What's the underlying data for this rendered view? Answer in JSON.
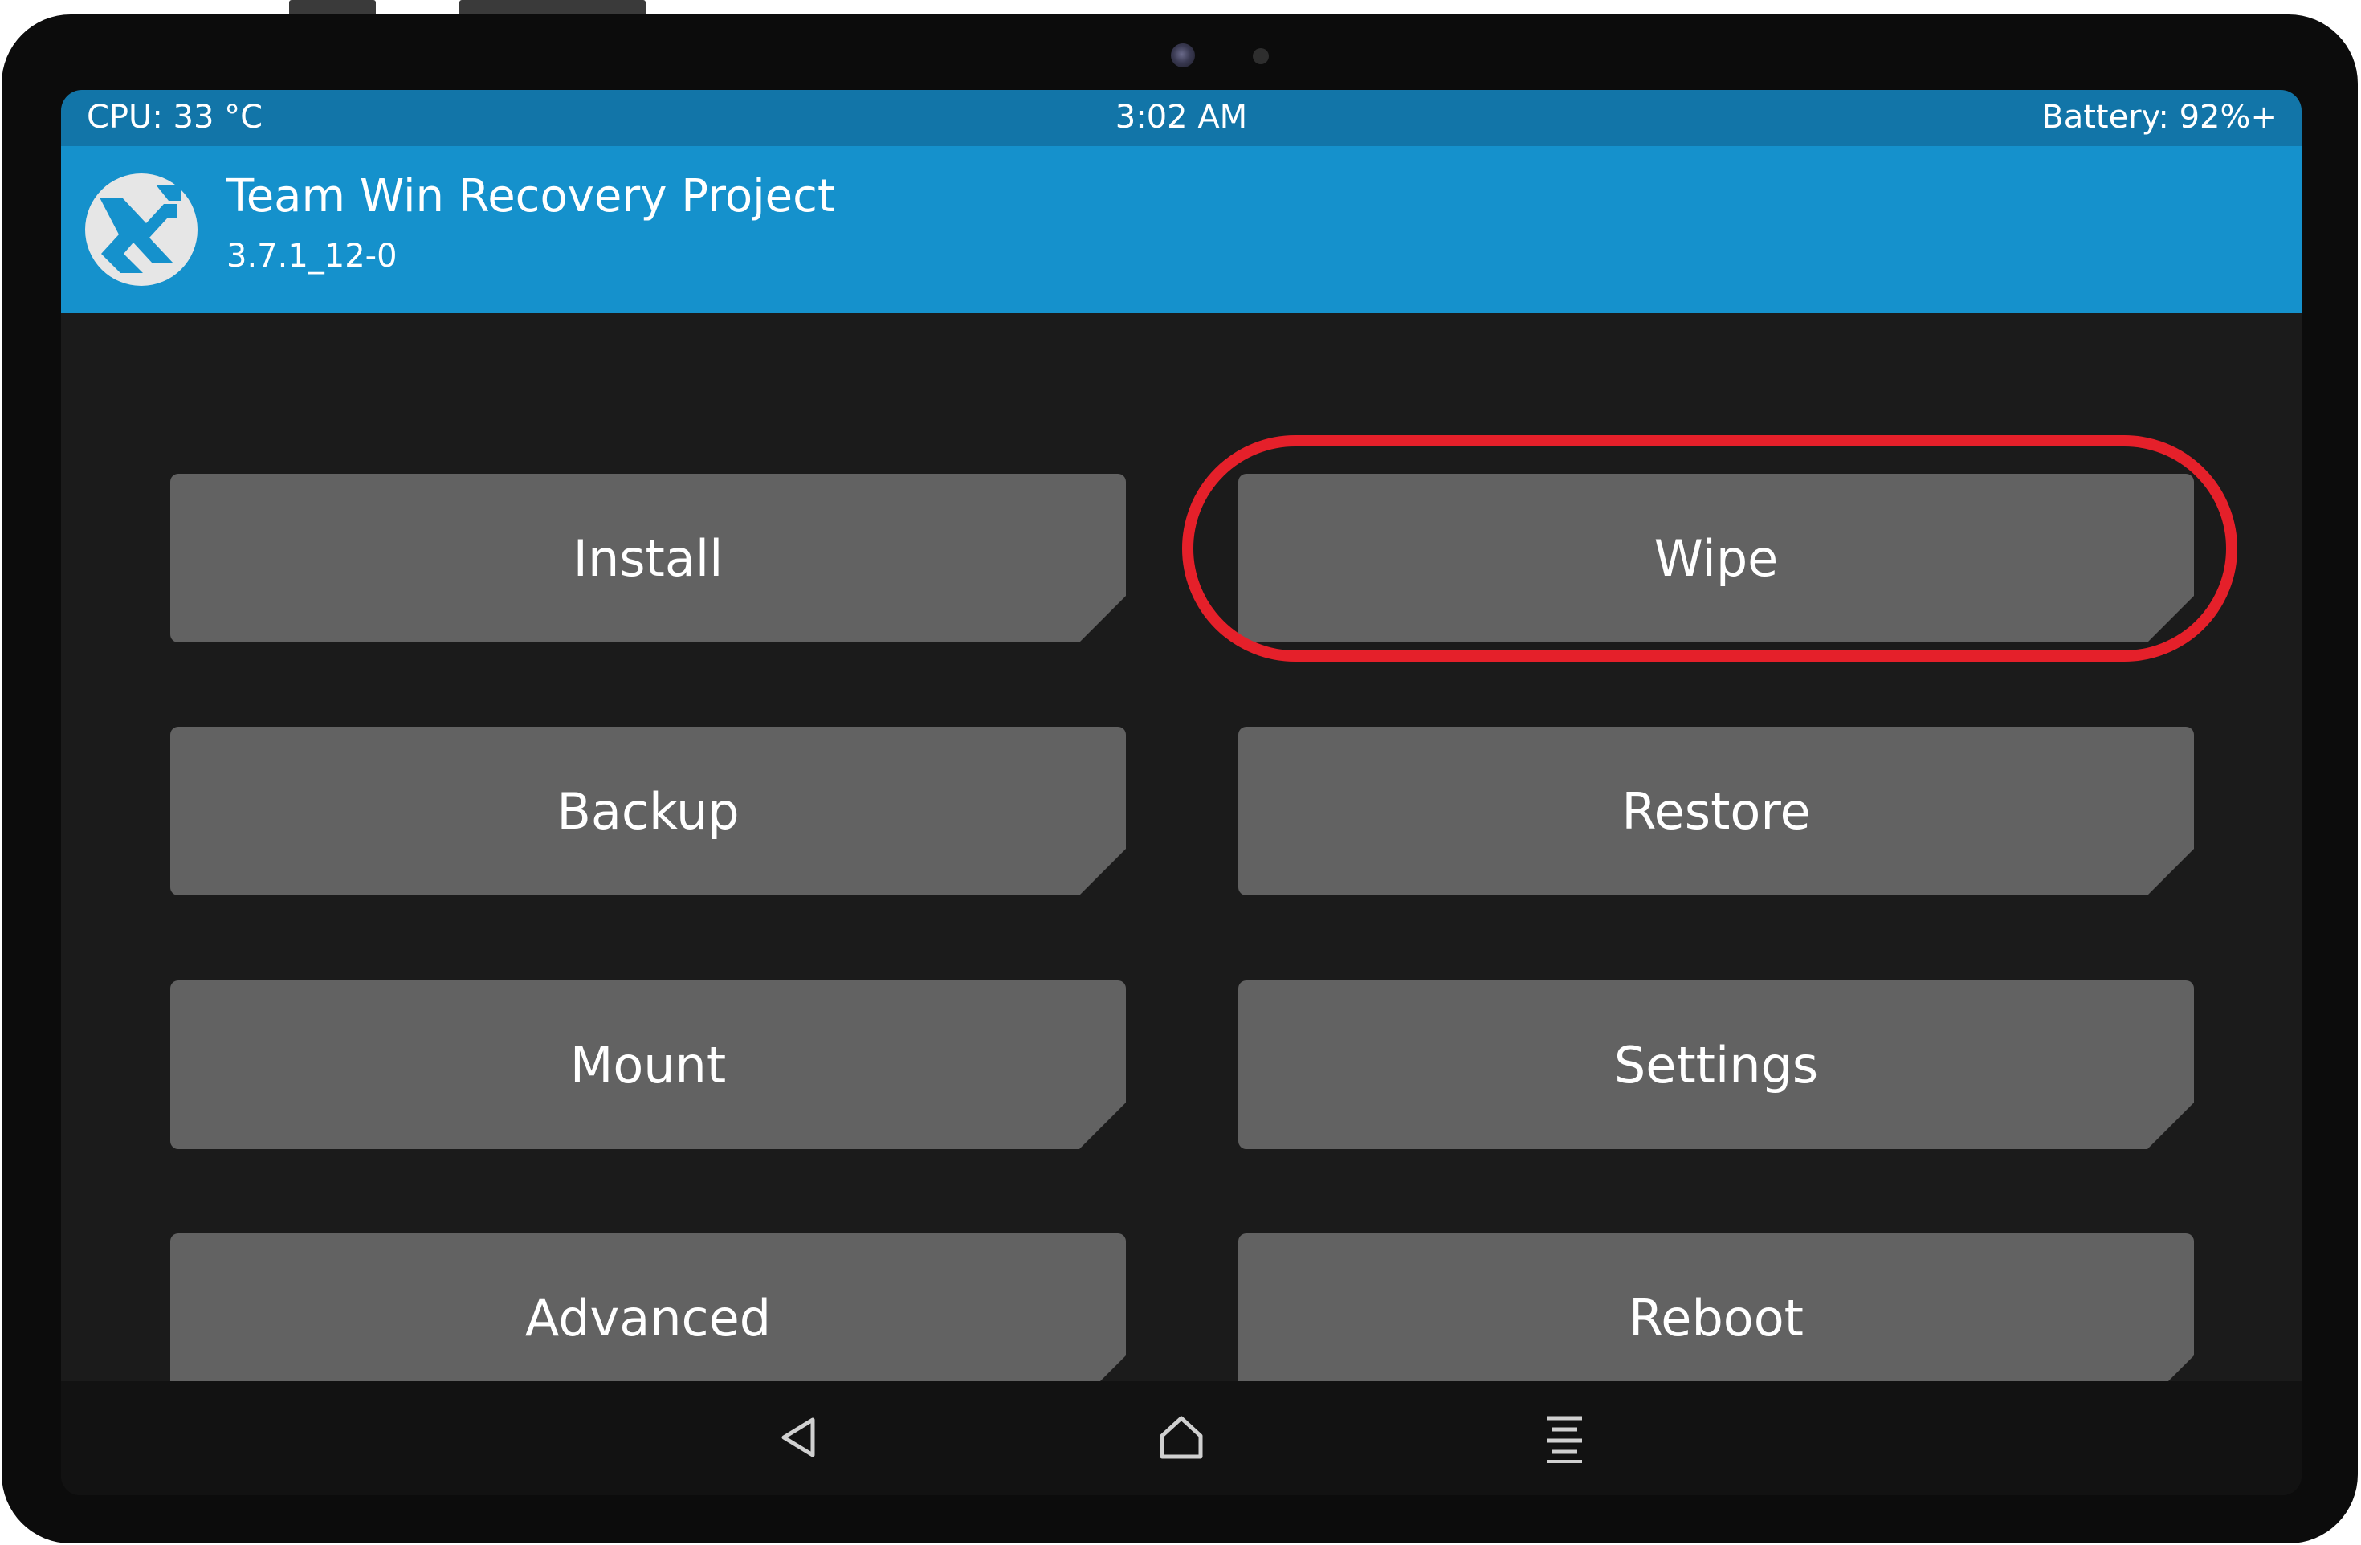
{
  "status_bar": {
    "cpu": "CPU: 33 °C",
    "time": "3:02 AM",
    "battery": "Battery: 92%+"
  },
  "header": {
    "title": "Team Win Recovery Project",
    "version": "3.7.1_12-0",
    "logo_icon": "twrp-logo-icon"
  },
  "menu": {
    "install": "Install",
    "wipe": "Wipe",
    "backup": "Backup",
    "restore": "Restore",
    "mount": "Mount",
    "settings": "Settings",
    "advanced": "Advanced",
    "reboot": "Reboot"
  },
  "highlight": {
    "target": "Wipe",
    "color": "#e5202a"
  },
  "nav_bar": {
    "back_icon": "back-triangle-icon",
    "home_icon": "home-icon",
    "menu_icon": "menu-lines-icon"
  },
  "colors": {
    "status_bar": "#1275a8",
    "header": "#1591cc",
    "tile": "#626262",
    "background": "#1b1b1b",
    "nav_bar": "#121212"
  }
}
